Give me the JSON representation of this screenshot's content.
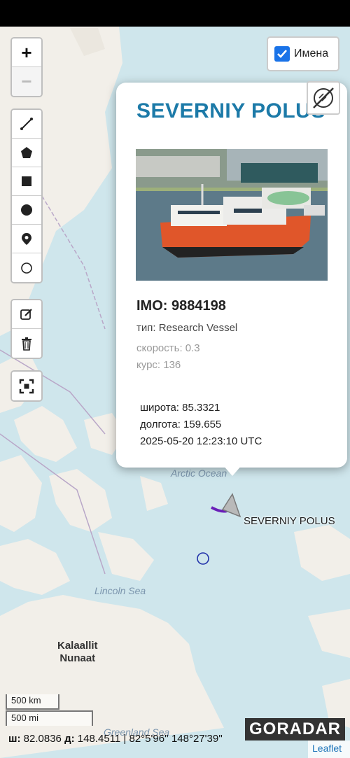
{
  "map": {
    "labels": {
      "arctic_ocean": "Arctic Ocean",
      "lincoln_sea": "Lincoln Sea",
      "greenland_sea": "Greenland Sea",
      "kalaallit_nunaat": "Kalaallit\nNunaat"
    }
  },
  "controls": {
    "zoom_in": "+",
    "zoom_out": "−",
    "draw_tools": [
      "polyline",
      "polygon",
      "rectangle",
      "circle",
      "marker",
      "circlemarker"
    ],
    "edit_tools": [
      "edit",
      "delete"
    ],
    "fullscreen": "fullscreen"
  },
  "names_toggle": {
    "label": "Имена",
    "checked": true
  },
  "popup": {
    "vessel_name": "SEVERNIY POLUS",
    "imo": "IMO: 9884198",
    "type": "тип: Research Vessel",
    "speed": "скорость: 0.3",
    "course": "курс: 136",
    "latitude": "широта: 85.3321",
    "longitude": "долгота: 159.655",
    "timestamp": "2025-05-20 12:23:10 UTC"
  },
  "vessel_marker_label": "SEVERNIY POLUS",
  "scale": {
    "metric": "500 km",
    "imperial": "500 mi"
  },
  "coordinates": {
    "lat_prefix": "ш:",
    "lat": "82.0836",
    "lon_prefix": "д:",
    "lon": "148.4511",
    "dms": "| 82°5'96'' 148°27'39''"
  },
  "logo": "GORADAR",
  "attribution": "Leaflet",
  "colors": {
    "accent": "#1c7aa8",
    "checkbox": "#1a73e8",
    "vessel_track": "#6a1fb8",
    "circle_marker": "#2233aa"
  }
}
